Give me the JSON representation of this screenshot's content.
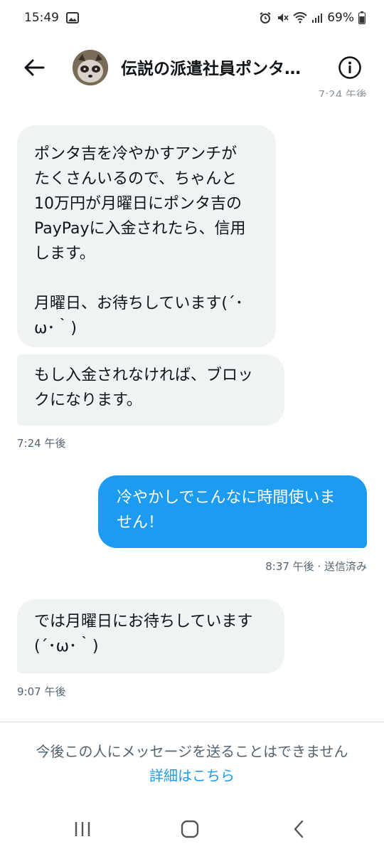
{
  "status_bar": {
    "time": "15:49",
    "battery": "69%",
    "icons": [
      "image-icon",
      "alarm-icon",
      "mute-icon",
      "wifi-icon",
      "signal-icon",
      "battery-icon"
    ]
  },
  "header": {
    "title": "伝説の派遣社員ポンタ…",
    "icons": [
      "back-arrow-icon",
      "avatar",
      "info-icon"
    ]
  },
  "clipped_timestamp": "7:24 午後",
  "messages": [
    {
      "direction": "incoming",
      "text": "ポンタ吉を冷やかすアンチが\nたくさんいるので、ちゃんと\n10万円が月曜日にポンタ吉の\nPayPayに入金されたら、信用\nします。\n\n月曜日、お待ちしています(´･\nω･｀)"
    },
    {
      "direction": "incoming",
      "text": "もし入金されなければ、ブロッ\nクになります。"
    },
    {
      "direction": "outgoing",
      "text": "冷やかしでこんなに時間使いま\nせん！"
    },
    {
      "direction": "incoming",
      "text": "では月曜日にお待ちしています\n(´･ω･｀)"
    }
  ],
  "meta": {
    "time1": "7:24 午後",
    "time2": "8:37 午後 · 送信済み",
    "time3": "9:07 午後"
  },
  "footer": {
    "notice": "今後この人にメッセージを送ることはできません",
    "link": "詳細はこちら"
  },
  "nav": {
    "icons": [
      "recent-apps-icon",
      "home-icon",
      "back-icon"
    ]
  },
  "colors": {
    "accent": "#1d9bf0",
    "incoming_bubble": "#eff3f4",
    "text": "#0f1419",
    "muted": "#536471"
  }
}
